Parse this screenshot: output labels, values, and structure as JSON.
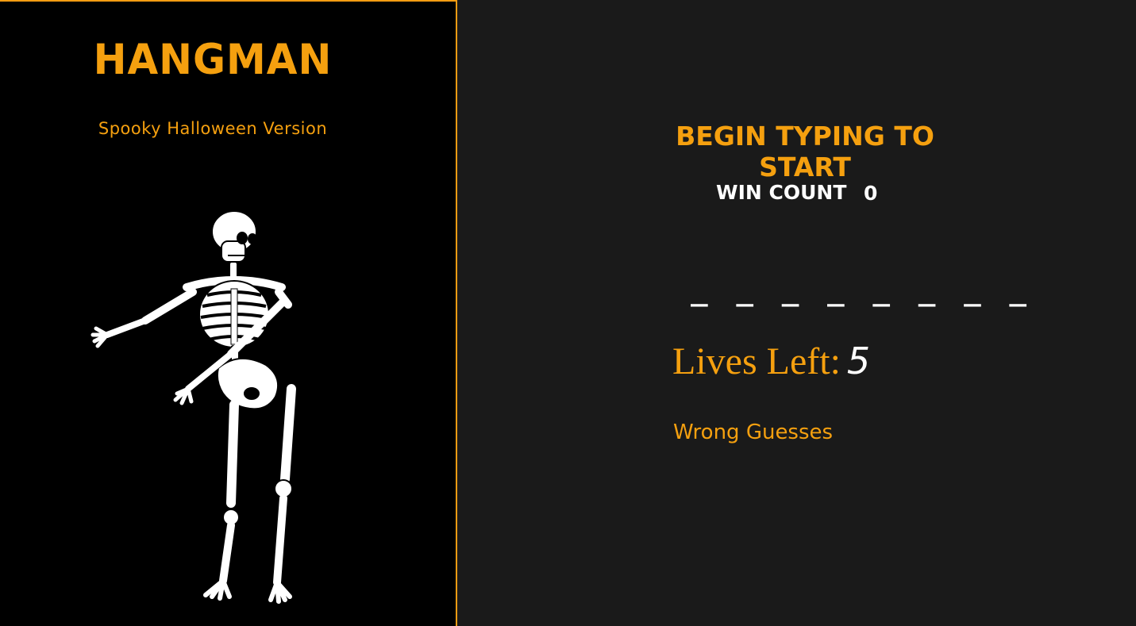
{
  "sidebar": {
    "title": "HANGMAN",
    "subtitle": "Spooky Halloween Version"
  },
  "main": {
    "start_prompt": "BEGIN TYPING TO START",
    "win_count_label": "WIN COUNT",
    "win_count_value": "0",
    "word_blanks": "_ _ _ _ _ _ _ _",
    "lives_label": "Lives Left:",
    "lives_value": "5",
    "wrong_guesses_label": "Wrong Guesses"
  },
  "colors": {
    "accent": "#f5a00f",
    "left_background": "#000000",
    "right_background": "#1a1a1a",
    "text_white": "#ffffff"
  }
}
